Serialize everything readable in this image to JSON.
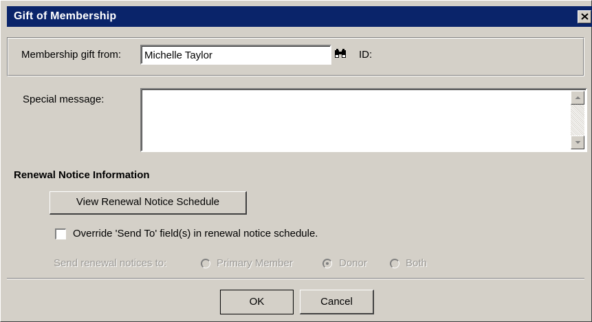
{
  "dialog": {
    "title": "Gift of Membership"
  },
  "membership": {
    "from_label": "Membership gift from:",
    "from_value": "Michelle Taylor",
    "id_label": "ID:",
    "message_label": "Special message:",
    "message_value": ""
  },
  "renewal": {
    "heading": "Renewal Notice Information",
    "view_schedule_button": "View Renewal Notice Schedule",
    "override_label": "Override 'Send To' field(s) in renewal notice schedule.",
    "override_checked": false,
    "send_to_label": "Send renewal notices to:",
    "options": [
      {
        "label": "Primary Member",
        "selected": false
      },
      {
        "label": "Donor",
        "selected": true
      },
      {
        "label": "Both",
        "selected": false
      }
    ]
  },
  "buttons": {
    "ok": "OK",
    "cancel": "Cancel"
  },
  "icons": {
    "close": "close-icon",
    "lookup": "binoculars-icon",
    "scroll_up": "arrow-up-icon",
    "scroll_down": "arrow-down-icon"
  }
}
